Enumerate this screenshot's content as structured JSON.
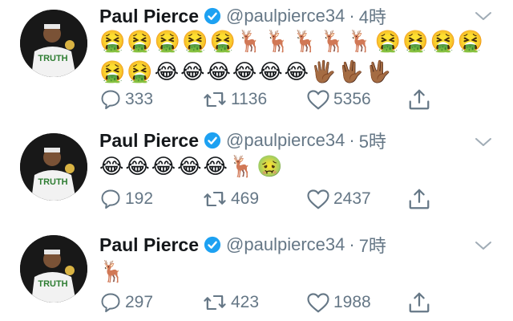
{
  "tweets": [
    {
      "name": "Paul Pierce",
      "handle": "@paulpierce34",
      "separator": "·",
      "time": "4時",
      "content_lines": [
        "🤮🤮🤮🤮🤮🦌🦌🦌🦌🦌🤮🤮🤮🤮",
        "🤮🤮😂😂😂😂😂😂🖐🏾🖖🏾🖖🏾"
      ],
      "replies": "333",
      "retweets": "1136",
      "likes": "5356"
    },
    {
      "name": "Paul Pierce",
      "handle": "@paulpierce34",
      "separator": "·",
      "time": "5時",
      "content_lines": [
        "😂😂😂😂😂🦌🤢"
      ],
      "replies": "192",
      "retweets": "469",
      "likes": "2437"
    },
    {
      "name": "Paul Pierce",
      "handle": "@paulpierce34",
      "separator": "·",
      "time": "7時",
      "content_lines": [
        "🦌"
      ],
      "replies": "297",
      "retweets": "423",
      "likes": "1988"
    }
  ],
  "avatar_text": "TRUTH",
  "colors": {
    "verified": "#1da1f2",
    "icon": "#657786",
    "text": "#14171a"
  },
  "icons": {
    "verified": "verified-badge-icon",
    "menu": "chevron-down-icon",
    "reply": "reply-icon",
    "retweet": "retweet-icon",
    "like": "heart-icon",
    "share": "share-icon"
  }
}
